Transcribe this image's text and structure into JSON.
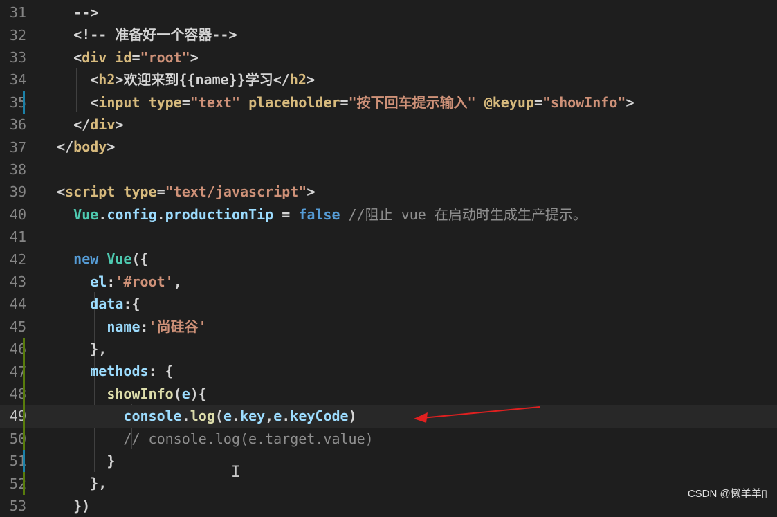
{
  "editor": {
    "lines": [
      {
        "num": "31",
        "segments": [
          {
            "c": "t-punct",
            "t": "    -->"
          }
        ]
      },
      {
        "num": "32",
        "segments": [
          {
            "c": "t-punct",
            "t": "    <!-- 准备好一个容器-->"
          }
        ]
      },
      {
        "num": "33",
        "segments": [
          {
            "c": "t-punct",
            "t": "    <"
          },
          {
            "c": "t-tag",
            "t": "div"
          },
          {
            "c": "t-text",
            "t": " "
          },
          {
            "c": "t-tag",
            "t": "id"
          },
          {
            "c": "t-punct",
            "t": "="
          },
          {
            "c": "t-str",
            "t": "\"root\""
          },
          {
            "c": "t-punct",
            "t": ">"
          }
        ]
      },
      {
        "num": "34",
        "segments": [
          {
            "c": "t-punct",
            "t": "      <"
          },
          {
            "c": "t-tag",
            "t": "h2"
          },
          {
            "c": "t-punct",
            "t": ">"
          },
          {
            "c": "t-text",
            "t": "欢迎来到{{name}}学习"
          },
          {
            "c": "t-punct",
            "t": "</"
          },
          {
            "c": "t-tag",
            "t": "h2"
          },
          {
            "c": "t-punct",
            "t": ">"
          }
        ]
      },
      {
        "num": "35",
        "segments": [
          {
            "c": "t-punct",
            "t": "      <"
          },
          {
            "c": "t-tag",
            "t": "input"
          },
          {
            "c": "t-text",
            "t": " "
          },
          {
            "c": "t-tag",
            "t": "type"
          },
          {
            "c": "t-punct",
            "t": "="
          },
          {
            "c": "t-str",
            "t": "\"text\""
          },
          {
            "c": "t-text",
            "t": " "
          },
          {
            "c": "t-tag",
            "t": "placeholder"
          },
          {
            "c": "t-punct",
            "t": "="
          },
          {
            "c": "t-str",
            "t": "\"按下回车提示输入\""
          },
          {
            "c": "t-text",
            "t": " "
          },
          {
            "c": "t-tag",
            "t": "@keyup"
          },
          {
            "c": "t-punct",
            "t": "="
          },
          {
            "c": "t-str",
            "t": "\"showInfo\""
          },
          {
            "c": "t-punct",
            "t": ">"
          }
        ]
      },
      {
        "num": "36",
        "segments": [
          {
            "c": "t-punct",
            "t": "    </"
          },
          {
            "c": "t-tag",
            "t": "div"
          },
          {
            "c": "t-punct",
            "t": ">"
          }
        ]
      },
      {
        "num": "37",
        "segments": [
          {
            "c": "t-punct",
            "t": "  </"
          },
          {
            "c": "t-tag",
            "t": "body"
          },
          {
            "c": "t-punct",
            "t": ">"
          }
        ]
      },
      {
        "num": "38",
        "segments": [
          {
            "c": "t-text",
            "t": ""
          }
        ]
      },
      {
        "num": "39",
        "segments": [
          {
            "c": "t-punct",
            "t": "  <"
          },
          {
            "c": "t-tag",
            "t": "script"
          },
          {
            "c": "t-text",
            "t": " "
          },
          {
            "c": "t-tag",
            "t": "type"
          },
          {
            "c": "t-punct",
            "t": "="
          },
          {
            "c": "t-str",
            "t": "\"text/javascript\""
          },
          {
            "c": "t-punct",
            "t": ">"
          }
        ]
      },
      {
        "num": "40",
        "segments": [
          {
            "c": "t-text",
            "t": "    "
          },
          {
            "c": "t-ent",
            "t": "Vue"
          },
          {
            "c": "t-punct",
            "t": "."
          },
          {
            "c": "t-var",
            "t": "config"
          },
          {
            "c": "t-punct",
            "t": "."
          },
          {
            "c": "t-var",
            "t": "productionTip"
          },
          {
            "c": "t-text",
            "t": " = "
          },
          {
            "c": "t-kw",
            "t": "false"
          },
          {
            "c": "t-text",
            "t": " "
          },
          {
            "c": "t-gray",
            "t": "//阻止 vue 在启动时生成生产提示。"
          }
        ]
      },
      {
        "num": "41",
        "segments": [
          {
            "c": "t-text",
            "t": ""
          }
        ]
      },
      {
        "num": "42",
        "segments": [
          {
            "c": "t-text",
            "t": "    "
          },
          {
            "c": "t-kw",
            "t": "new"
          },
          {
            "c": "t-text",
            "t": " "
          },
          {
            "c": "t-ent",
            "t": "Vue"
          },
          {
            "c": "t-punct",
            "t": "({"
          }
        ]
      },
      {
        "num": "43",
        "segments": [
          {
            "c": "t-text",
            "t": "      "
          },
          {
            "c": "t-key",
            "t": "el"
          },
          {
            "c": "t-punct",
            "t": ":"
          },
          {
            "c": "t-str",
            "t": "'#root'"
          },
          {
            "c": "t-punct",
            "t": ","
          }
        ]
      },
      {
        "num": "44",
        "segments": [
          {
            "c": "t-text",
            "t": "      "
          },
          {
            "c": "t-key",
            "t": "data"
          },
          {
            "c": "t-punct",
            "t": ":{"
          }
        ]
      },
      {
        "num": "45",
        "segments": [
          {
            "c": "t-text",
            "t": "        "
          },
          {
            "c": "t-key",
            "t": "name"
          },
          {
            "c": "t-punct",
            "t": ":"
          },
          {
            "c": "t-str",
            "t": "'尚硅谷'"
          }
        ]
      },
      {
        "num": "46",
        "segments": [
          {
            "c": "t-punct",
            "t": "      },"
          }
        ]
      },
      {
        "num": "47",
        "segments": [
          {
            "c": "t-text",
            "t": "      "
          },
          {
            "c": "t-key",
            "t": "methods"
          },
          {
            "c": "t-punct",
            "t": ": {"
          }
        ]
      },
      {
        "num": "48",
        "segments": [
          {
            "c": "t-text",
            "t": "        "
          },
          {
            "c": "t-fn",
            "t": "showInfo"
          },
          {
            "c": "t-punct",
            "t": "("
          },
          {
            "c": "t-var",
            "t": "e"
          },
          {
            "c": "t-punct",
            "t": "){"
          }
        ]
      },
      {
        "num": "49",
        "segments": [
          {
            "c": "t-text",
            "t": "          "
          },
          {
            "c": "t-var",
            "t": "console"
          },
          {
            "c": "t-punct",
            "t": "."
          },
          {
            "c": "t-fn",
            "t": "log"
          },
          {
            "c": "t-punct",
            "t": "("
          },
          {
            "c": "t-var",
            "t": "e"
          },
          {
            "c": "t-punct",
            "t": "."
          },
          {
            "c": "t-var",
            "t": "key"
          },
          {
            "c": "t-punct",
            "t": ","
          },
          {
            "c": "t-var",
            "t": "e"
          },
          {
            "c": "t-punct",
            "t": "."
          },
          {
            "c": "t-var",
            "t": "keyCode"
          },
          {
            "c": "t-punct",
            "t": ")"
          }
        ]
      },
      {
        "num": "50",
        "segments": [
          {
            "c": "t-text",
            "t": "          "
          },
          {
            "c": "t-gray",
            "t": "// console.log(e.target.value)"
          }
        ]
      },
      {
        "num": "51",
        "segments": [
          {
            "c": "t-punct",
            "t": "        }"
          }
        ]
      },
      {
        "num": "52",
        "segments": [
          {
            "c": "t-punct",
            "t": "      },"
          }
        ]
      },
      {
        "num": "53",
        "segments": [
          {
            "c": "t-punct",
            "t": "    })"
          }
        ]
      }
    ],
    "current_line": "49"
  },
  "watermark": "CSDN @懒羊羊▯",
  "colors": {
    "background": "#1e1e1e",
    "arrow": "#e02020",
    "gutter_modified_blue": "#1b81a8",
    "gutter_modified_green": "#587c0c"
  }
}
